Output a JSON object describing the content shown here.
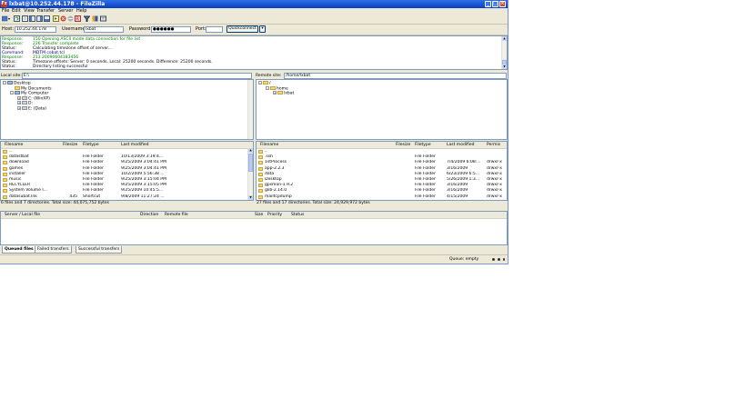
{
  "window": {
    "title": "lxbat@10.252.44.178 - FileZilla",
    "app_icon": "Fz",
    "buttons": {
      "minimize": "_",
      "maximize": "□",
      "close": "×"
    }
  },
  "menu": [
    "File",
    "Edit",
    "View",
    "Transfer",
    "Server",
    "Help"
  ],
  "toolbar_icons": [
    "site-manager-icon",
    "refresh-icon",
    "toggle-log-icon",
    "toggle-local-tree-icon",
    "toggle-remote-tree-icon",
    "toggle-queue-icon",
    "process-queue-icon",
    "cancel-icon",
    "disconnect-icon",
    "reconnect-icon",
    "filter-icon",
    "compare-icon",
    "search-icon"
  ],
  "quickconnect": {
    "host_label": "Host:",
    "host_value": "10.252.44.178",
    "username_label": "Username:",
    "username_value": "lxbat",
    "password_label": "Password:",
    "password_value": "●●●●●●",
    "port_label": "Port:",
    "port_value": "",
    "button_label": "Quickconnect",
    "dropdown": "▾"
  },
  "log": [
    {
      "k": "Response:",
      "v": "150 Opening ASCII mode data connection for file list",
      "color": "#008000"
    },
    {
      "k": "Response:",
      "v": "226 Transfer complete",
      "color": "#008000"
    },
    {
      "k": "Status:",
      "v": "Calculating timezone offset of server...",
      "color": "#000000"
    },
    {
      "k": "Command:",
      "v": "MDTM cobat.tcl",
      "color": "#000080"
    },
    {
      "k": "Response:",
      "v": "213 20090604183456",
      "color": "#008000"
    },
    {
      "k": "Status:",
      "v": "Timezone offsets: Server: 0 seconds. Local: 25200 seconds. Difference: 25200 seconds.",
      "color": "#000000"
    },
    {
      "k": "Status:",
      "v": "Directory listing successful",
      "color": "#000000"
    }
  ],
  "local": {
    "site_label": "Local site:",
    "site_value": "E:\\",
    "tree": [
      {
        "label": "Desktop",
        "depth": 0,
        "icon": "desktop-icon",
        "exp": "-"
      },
      {
        "label": "My Documents",
        "depth": 1,
        "icon": "folder-icon",
        "exp": ""
      },
      {
        "label": "My Computer",
        "depth": 1,
        "icon": "computer-icon",
        "exp": "-"
      },
      {
        "label": "C: (WinXP)",
        "depth": 2,
        "icon": "drive-icon",
        "exp": "+"
      },
      {
        "label": "D:",
        "depth": 2,
        "icon": "drive-icon",
        "exp": "+"
      },
      {
        "label": "E: (Data)",
        "depth": 2,
        "icon": "drive-icon",
        "exp": "+"
      }
    ],
    "columns": [
      "Filename",
      "Filesize",
      "Filetype",
      "Last modified"
    ],
    "files": [
      {
        "name": "..",
        "size": "",
        "type": "",
        "modified": ""
      },
      {
        "name": "datastbat",
        "size": "",
        "type": "File Folder",
        "modified": "10/13/2009 3:19:4..."
      },
      {
        "name": "download",
        "size": "",
        "type": "File Folder",
        "modified": "9/25/2009 3:04:41 PM"
      },
      {
        "name": "games",
        "size": "",
        "type": "File Folder",
        "modified": "9/25/2009 3:04:41 PM"
      },
      {
        "name": "installer",
        "size": "",
        "type": "File Folder",
        "modified": "10/2/2009 5:56:38 ..."
      },
      {
        "name": "music",
        "size": "",
        "type": "File Folder",
        "modified": "9/25/2009 3:15:04 PM"
      },
      {
        "name": "RECYCLER",
        "size": "",
        "type": "File Folder",
        "modified": "9/25/2009 3:15:05 PM"
      },
      {
        "name": "System Volume I...",
        "size": "",
        "type": "File Folder",
        "modified": "9/25/2009 10:45:5..."
      },
      {
        "name": "datasubat.lnk",
        "size": "435",
        "type": "Shortcut",
        "modified": "9/8/2009 11:27:24 ..."
      }
    ],
    "status": "6 files and 7 directories. Total size: 44,075,752 bytes"
  },
  "remote": {
    "site_label": "Remote site:",
    "site_value": "/home/lxbat",
    "tree": [
      {
        "label": "/",
        "depth": 0,
        "icon": "folder-icon",
        "exp": "-"
      },
      {
        "label": "home",
        "depth": 1,
        "icon": "folder-icon",
        "exp": "-"
      },
      {
        "label": "lxbat",
        "depth": 2,
        "icon": "folder-icon",
        "exp": "+"
      }
    ],
    "columns": [
      "Filename",
      "Filesize",
      "Filetype",
      "Last modified",
      "Permis"
    ],
    "files": [
      {
        "name": "..",
        "size": "",
        "type": "",
        "modified": "",
        "perm": ""
      },
      {
        "name": ".ssh",
        "size": "",
        "type": "File Folder",
        "modified": "",
        "perm": ""
      },
      {
        "name": "1stProcess",
        "size": "",
        "type": "File Folder",
        "modified": "7/4/2009 6:08:...",
        "perm": "drwxr-x"
      },
      {
        "name": "app-2.2.3",
        "size": "",
        "type": "File Folder",
        "modified": "3/16/2009",
        "perm": "drwxr-x"
      },
      {
        "name": "data",
        "size": "",
        "type": "File Folder",
        "modified": "6/23/2009 6:5...",
        "perm": "drwxr-x"
      },
      {
        "name": "Desktop",
        "size": "",
        "type": "File Folder",
        "modified": "5/26/2009 1:3...",
        "perm": "drwxr-x"
      },
      {
        "name": "gpsmon-1.9.2",
        "size": "",
        "type": "File Folder",
        "modified": "3/16/2009",
        "perm": "drwxr-x"
      },
      {
        "name": "glib-2.14.0",
        "size": "",
        "type": "File Folder",
        "modified": "3/16/2009",
        "perm": "drwxr-x"
      },
      {
        "name": "mailtcpdump",
        "size": "",
        "type": "File Folder",
        "modified": "4/15/2009",
        "perm": "drwxr-x"
      }
    ],
    "status": "27 files and 17 directories. Total size: 24,929,972 bytes"
  },
  "queue": {
    "columns": [
      "Server / Local file",
      "Direction",
      "Remote file",
      "Size",
      "Priority",
      "Status"
    ],
    "tabs": [
      "Queued files",
      "Failed transfers",
      "Successful transfers"
    ],
    "status": "Queue: empty"
  },
  "colors": {
    "titlebar": "#0a3fc0",
    "panel_bg": "#ece9d8",
    "folder": "#f6d774"
  }
}
